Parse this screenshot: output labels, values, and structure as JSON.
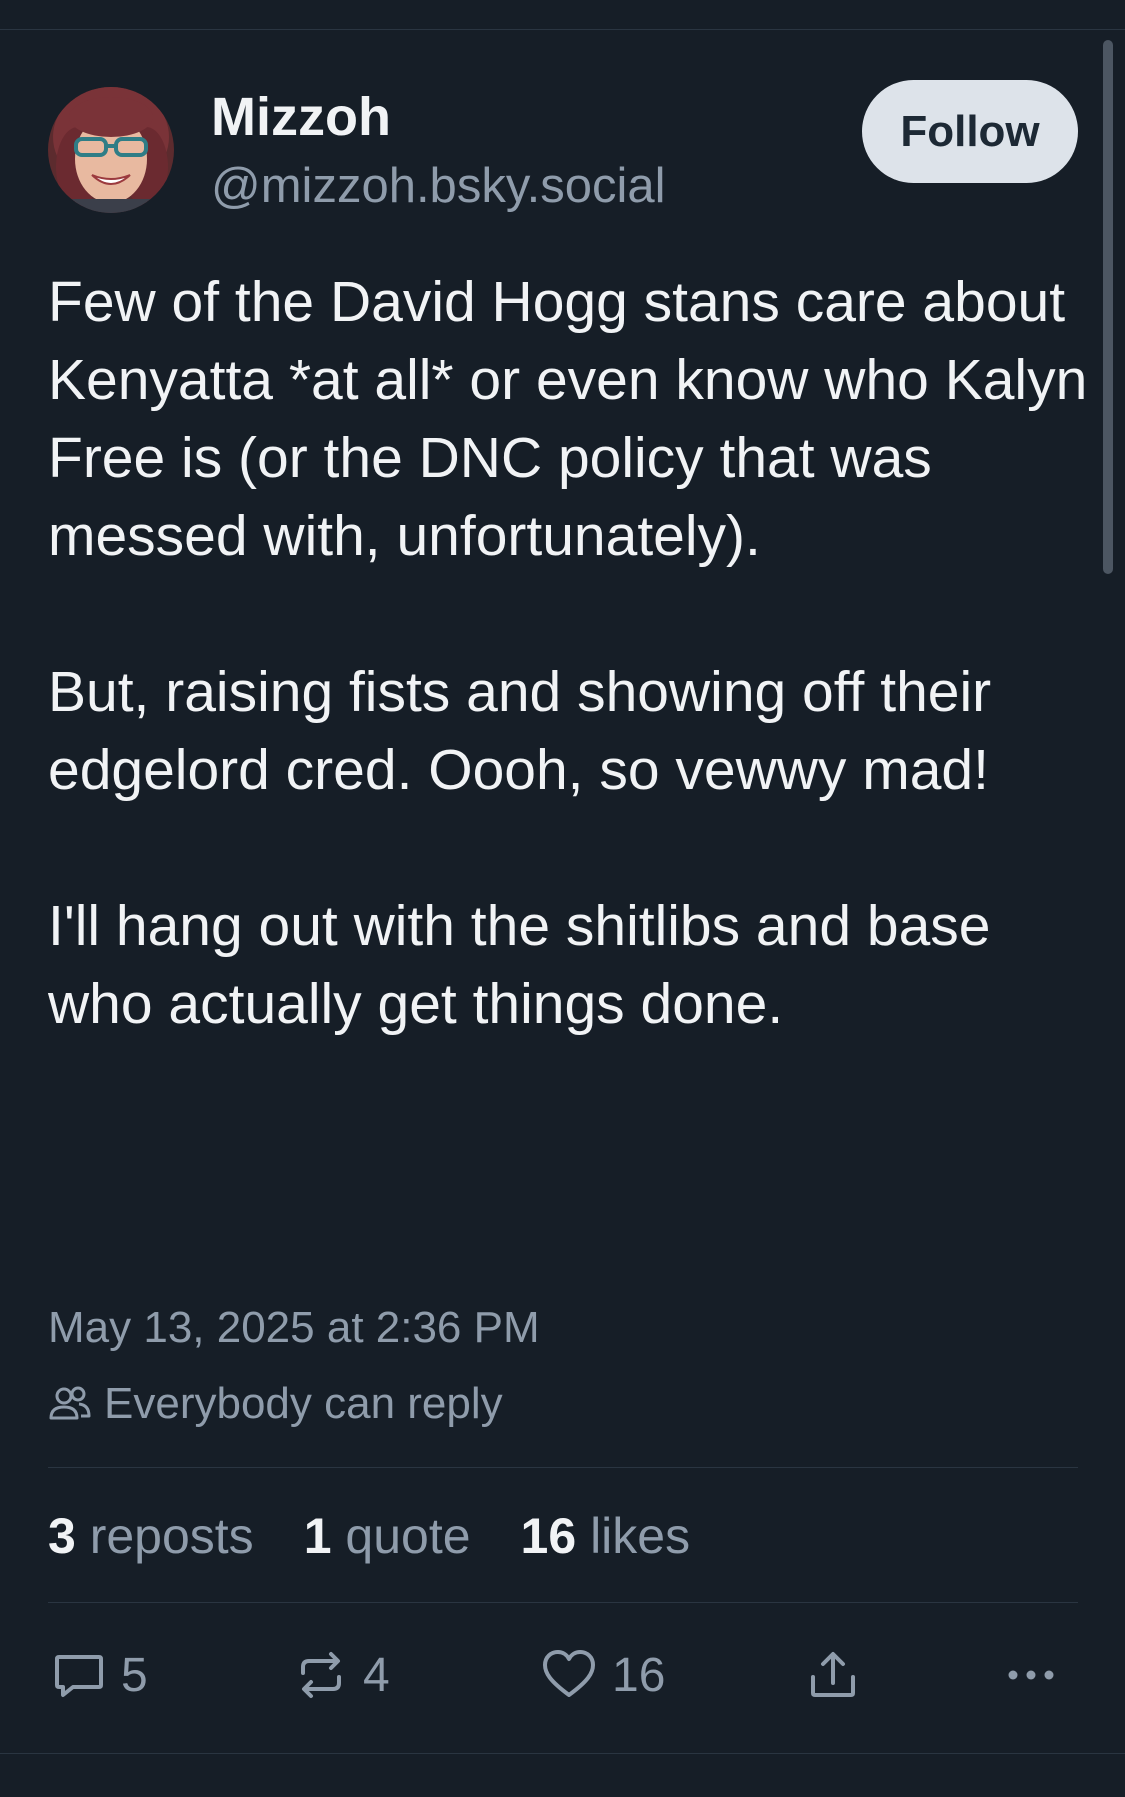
{
  "author": {
    "name": "Mizzoh",
    "handle": "@mizzoh.bsky.social",
    "follow_label": "Follow"
  },
  "post": {
    "paragraphs": [
      "Few of the David Hogg stans care about Kenyatta *at all* or even know who Kalyn Free is (or the DNC policy that was messed with, unfortunately).",
      "But, raising fists and showing off their edgelord cred. Oooh, so vewwy mad!",
      "I'll hang out with the shitlibs and base who actually get things done."
    ],
    "timestamp": "May 13, 2025 at 2:36 PM",
    "reply_setting": "Everybody can reply"
  },
  "stats": {
    "reposts_count": "3",
    "reposts_label": "reposts",
    "quotes_count": "1",
    "quotes_label": "quote",
    "likes_count": "16",
    "likes_label": "likes"
  },
  "actions": {
    "reply_count": "5",
    "repost_count": "4",
    "like_count": "16"
  },
  "icons": {
    "reply": "reply-bubble-icon",
    "repost": "repost-arrows-icon",
    "like": "heart-icon",
    "share": "share-upload-icon",
    "more": "more-dots-icon",
    "audience": "people-icon"
  },
  "colors": {
    "background": "#161e27",
    "text_primary": "#f1f3f5",
    "text_secondary": "#8f9cab",
    "follow_bg": "#dde3ea",
    "divider": "#2a3541"
  }
}
